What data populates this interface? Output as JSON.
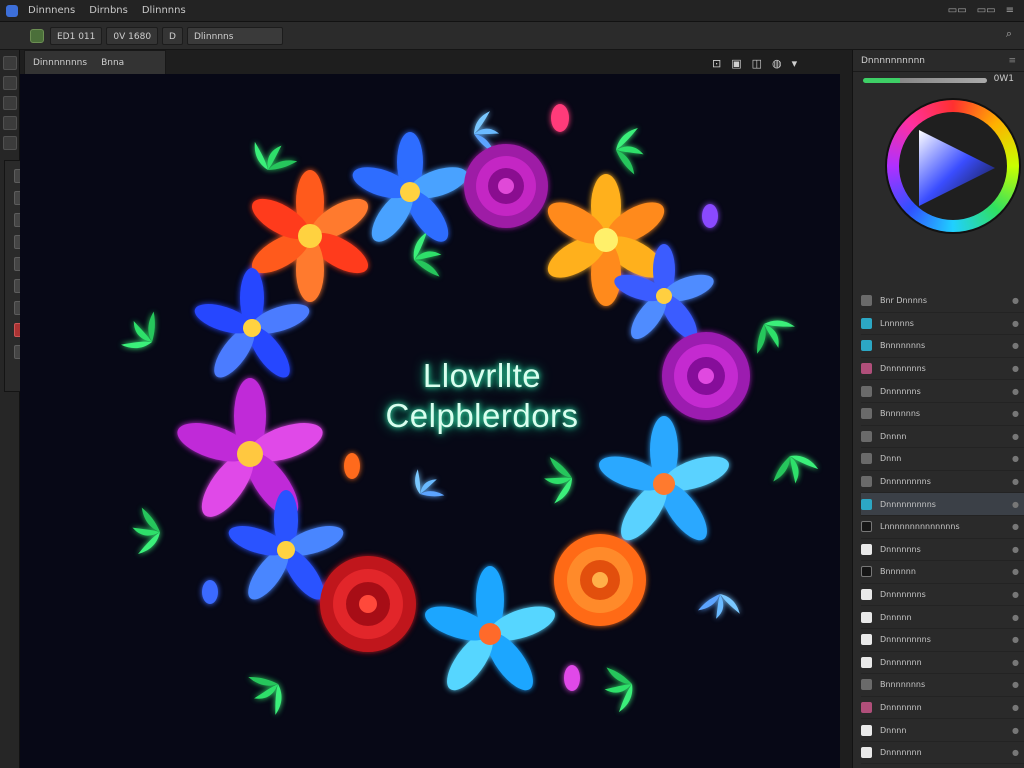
{
  "menubar": {
    "items": [
      "Dinnnens",
      "Dirnbns",
      "Dlinnnns"
    ],
    "window_controls": [
      "▭▭",
      "▭▭",
      "≡"
    ]
  },
  "options": {
    "items": [
      "ED1 011",
      "0V 1680",
      "D"
    ],
    "field_value": "Dlinnnns"
  },
  "document": {
    "tab_name": "Dinnnnnnns",
    "tab_size": "Bnna"
  },
  "artwork": {
    "title_line1": "Llovrllte",
    "title_line2": "Celpblerdors"
  },
  "right_panel": {
    "header": "Dnnnnnnnnnn",
    "slider_value": "0W1"
  },
  "layers": [
    {
      "name": "Bnr Dnnnns",
      "thumb": "gray"
    },
    {
      "name": "Lnnnnns",
      "thumb": "teal"
    },
    {
      "name": "Bnnnnnnns",
      "thumb": "teal"
    },
    {
      "name": "Dnnnnnnns",
      "thumb": "pink"
    },
    {
      "name": "Dnnnnnns",
      "thumb": "gray"
    },
    {
      "name": "Bnnnnnns",
      "thumb": "gray"
    },
    {
      "name": "Dnnnn",
      "thumb": "gray"
    },
    {
      "name": "Dnnn",
      "thumb": "gray"
    },
    {
      "name": "Dnnnnnnnns",
      "thumb": "gray"
    },
    {
      "name": "Dnnnnnnnnns",
      "thumb": "teal",
      "active": true
    },
    {
      "name": "Lnnnnnnnnnnnnnns",
      "thumb": "dark"
    },
    {
      "name": "Dnnnnnns",
      "thumb": "blank"
    },
    {
      "name": "Bnnnnnn",
      "thumb": "dark"
    },
    {
      "name": "Dnnnnnnns",
      "thumb": "blank"
    },
    {
      "name": "Dnnnnn",
      "thumb": "blank"
    },
    {
      "name": "Dnnnnnnnns",
      "thumb": "blank"
    },
    {
      "name": "Dnnnnnnn",
      "thumb": "blank"
    },
    {
      "name": "Bnnnnnnns",
      "thumb": "gray"
    },
    {
      "name": "Dnnnnnnn",
      "thumb": "pink"
    },
    {
      "name": "Dnnnn",
      "thumb": "blank"
    },
    {
      "name": "Dnnnnnnn",
      "thumb": "blank"
    },
    {
      "name": "Dnnnnnnnn",
      "thumb": "gray"
    }
  ],
  "colors": {
    "accent_green": "#3ecf66",
    "canvas_bg": "#070816"
  }
}
